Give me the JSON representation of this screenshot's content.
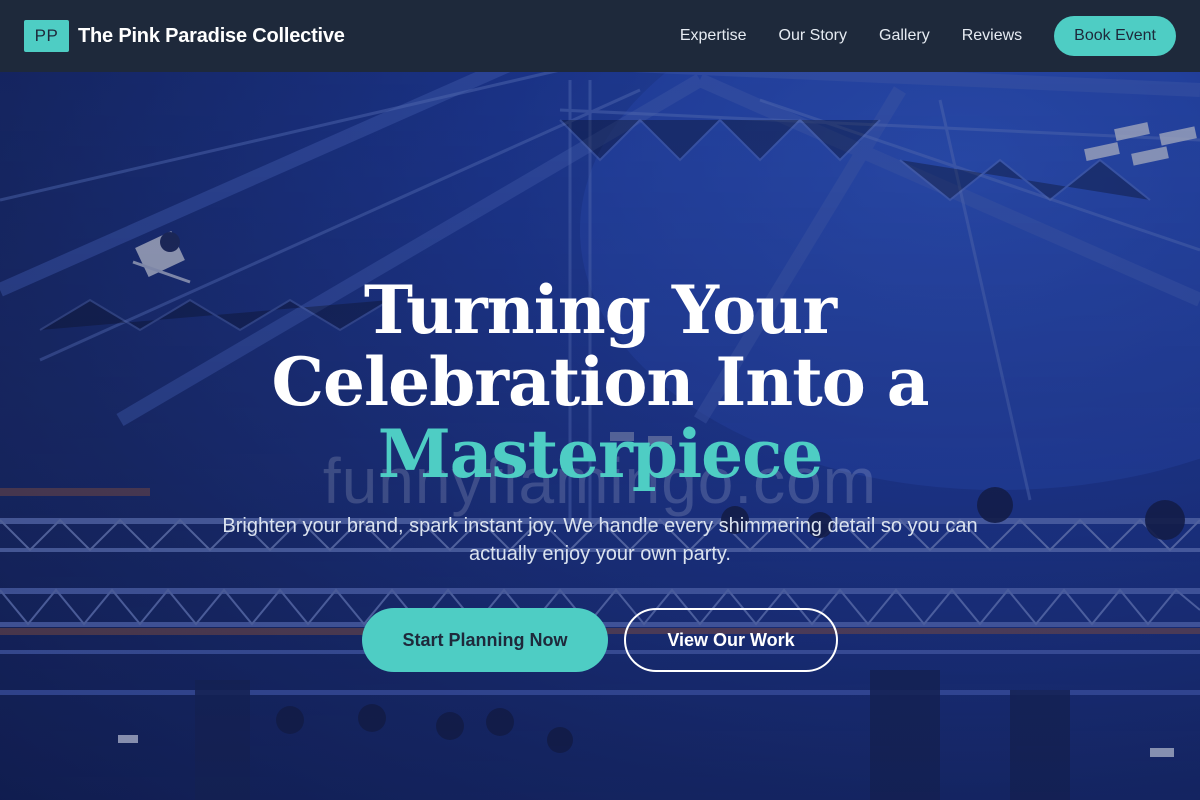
{
  "brand": {
    "logo_text": "PP",
    "name": "The Pink Paradise Collective"
  },
  "nav": {
    "links": [
      "Expertise",
      "Our Story",
      "Gallery",
      "Reviews"
    ],
    "cta_label": "Book Event"
  },
  "hero": {
    "title_line1": "Turning Your",
    "title_line2": "Celebration Into a",
    "title_accent": "Masterpiece",
    "subtitle": "Brighten your brand, spark instant joy. We handle every shimmering detail so you can actually enjoy your own party.",
    "primary_button": "Start Planning Now",
    "secondary_button": "View Our Work",
    "watermark": "funnyflamingo.com"
  },
  "colors": {
    "accent": "#4ecdc4",
    "navbar": "#1e293b",
    "background": "#1d3da8"
  },
  "icons": {
    "background": "stage-truss-lighting-photo"
  }
}
